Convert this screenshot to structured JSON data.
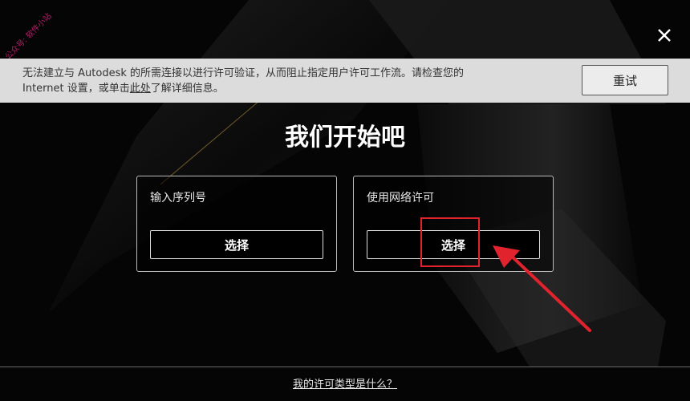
{
  "watermark": "公众号: 软件小站",
  "banner": {
    "line1": "无法建立与 Autodesk 的所需连接以进行许可验证，从而阻止指定用户许可工作流。请检查您的",
    "line2_prefix": "Internet 设置，或单击",
    "line2_link": "此处",
    "line2_suffix": "了解详细信息。",
    "retry_label": "重试"
  },
  "title": "我们开始吧",
  "cards": [
    {
      "label": "输入序列号",
      "button": "选择"
    },
    {
      "label": "使用网络许可",
      "button": "选择"
    }
  ],
  "footer_link": "我的许可类型是什么？",
  "colors": {
    "highlight": "#e0232d",
    "arrow": "#e0232d",
    "banner_bg": "#dcdcdc"
  }
}
